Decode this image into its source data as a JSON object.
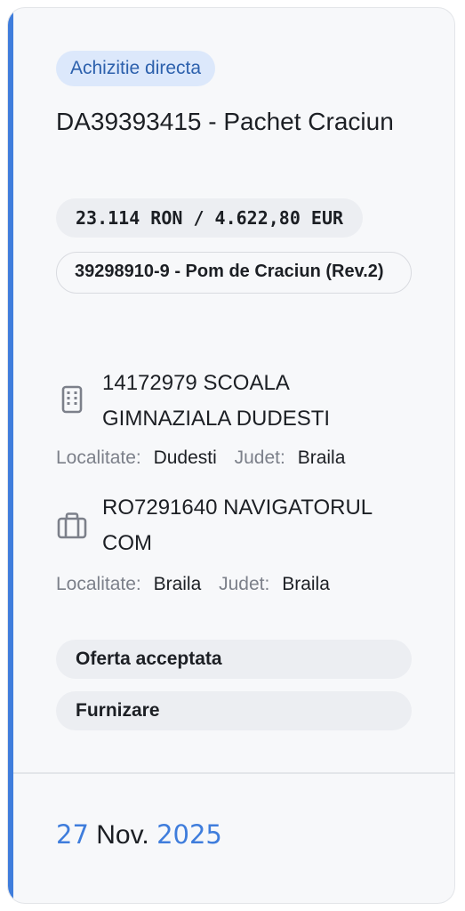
{
  "card": {
    "badge": "Achizitie directa",
    "title": "DA39393415 - Pachet Craciun",
    "price": "23.114 RON / 4.622,80 EUR",
    "cpv": "39298910-9 - Pom de Craciun (Rev.2)",
    "authority": {
      "icon": "building-icon",
      "name": "14172979 SCOALA GIMNAZIALA DUDESTI",
      "localitate_label": "Localitate:",
      "localitate": "Dudesti",
      "judet_label": "Judet:",
      "judet": "Braila"
    },
    "supplier": {
      "icon": "briefcase-icon",
      "name": "RO7291640 NAVIGATORUL COM",
      "localitate_label": "Localitate:",
      "localitate": "Braila",
      "judet_label": "Judet:",
      "judet": "Braila"
    },
    "status": "Oferta acceptata",
    "type": "Furnizare",
    "date": {
      "day": "27",
      "month": "Nov.",
      "year": "2025"
    },
    "accent_color": "#3f7ddc",
    "badge_color": "#dce8fb"
  }
}
